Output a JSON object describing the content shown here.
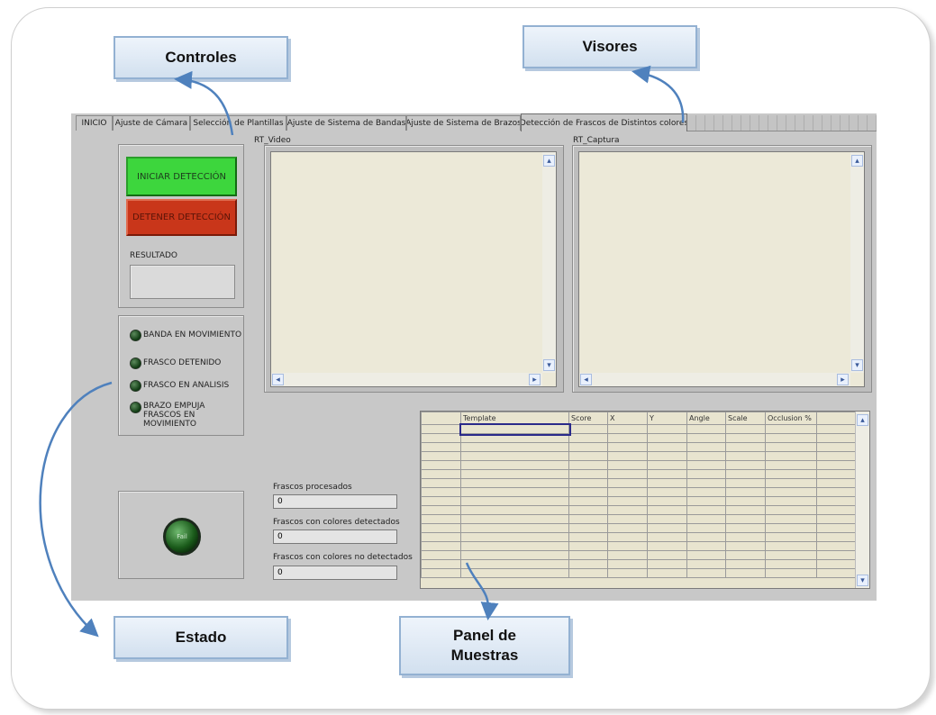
{
  "callouts": {
    "controles": "Controles",
    "visores": "Visores",
    "estado": "Estado",
    "panel_muestras": "Panel de Muestras"
  },
  "tabs": [
    {
      "label": "INICIO"
    },
    {
      "label": "Ajuste de Cámara"
    },
    {
      "label": "Selección de Plantillas"
    },
    {
      "label": "Ajuste de Sistema de Bandas"
    },
    {
      "label": "Ajuste de Sistema de Brazos"
    },
    {
      "label": "Detección de Frascos de Distintos colores",
      "active": true
    }
  ],
  "controls": {
    "start_label": "INICIAR DETECCIÓN",
    "stop_label": "DETENER DETECCIÓN",
    "result_label": "RESULTADO",
    "result_value": "",
    "start_color": "#3dd63d",
    "stop_color": "#c9361a"
  },
  "status": {
    "leds": [
      {
        "label": "BANDA EN MOVIMIENTO"
      },
      {
        "label": "FRASCO DETENIDO"
      },
      {
        "label": "FRASCO EN ANALISIS"
      },
      {
        "label": "BRAZO EMPUJA FRASCOS EN MOVIMIENTO"
      }
    ],
    "pass_fail_label": "Fail"
  },
  "viewers": {
    "video_label": "RT_Video",
    "capture_label": "RT_Captura"
  },
  "counters": [
    {
      "label": "Frascos procesados",
      "value": "0"
    },
    {
      "label": "Frascos con colores detectados",
      "value": "0"
    },
    {
      "label": "Frascos con colores no detectados",
      "value": "0"
    }
  ],
  "table": {
    "columns": [
      "",
      "Template",
      "Score",
      "X",
      "Y",
      "Angle",
      "Scale",
      "Occlusion %",
      ""
    ]
  },
  "icons": {
    "scroll_up": "▴",
    "scroll_down": "▾",
    "scroll_left": "◂",
    "scroll_right": "▸"
  }
}
